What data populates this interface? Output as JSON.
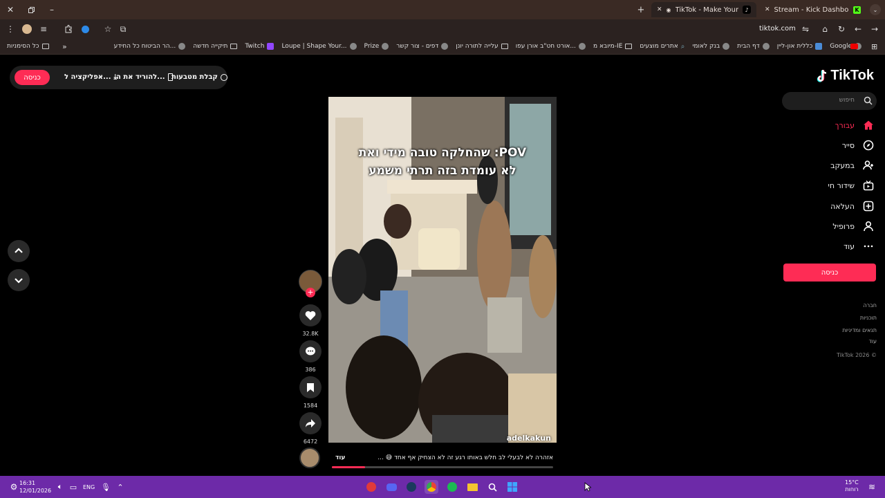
{
  "browser": {
    "tabs": [
      {
        "title": "TikTok - Make Your Day",
        "active": true
      },
      {
        "title": "Stream - Kick Dashboard",
        "active": false
      }
    ],
    "url": "tiktok.com",
    "bookmarks": [
      {
        "label": "Google",
        "icon": "google-icon"
      },
      {
        "label": "כללית און-ליין",
        "icon": "clalit-icon"
      },
      {
        "label": "דף הבית",
        "icon": "globe-icon"
      },
      {
        "label": "בנק לאומי",
        "icon": "globe-icon"
      },
      {
        "label": "אתרים מוצעים",
        "icon": "search-icon"
      },
      {
        "label": "מיובא מ-IE",
        "icon": "folder-icon"
      },
      {
        "label": "אורט חט\"ב אורן עפו...",
        "icon": "globe-icon"
      },
      {
        "label": "עלייה לתורה יונן",
        "icon": "folder-icon"
      },
      {
        "label": "דפים - צור קשר",
        "icon": "globe-icon"
      },
      {
        "label": "Prize",
        "icon": "globe-icon"
      },
      {
        "label": "Loupe | Shape Your...",
        "icon": "globe-icon"
      },
      {
        "label": "Twitch",
        "icon": "twitch-icon"
      },
      {
        "label": "תיקייה חדשה",
        "icon": "folder-icon"
      },
      {
        "label": "הר הביטוח כל החידע...",
        "icon": "globe-icon"
      }
    ],
    "all_bookmarks": "כל הסימניות"
  },
  "tiktok": {
    "logo": "TikTok",
    "login_top": "כניסה",
    "top_links": {
      "coins": "קבלת מטבעות",
      "download": "להוריד את ה...",
      "app": "אפליקציה ל..."
    },
    "search_placeholder": "חיפוש",
    "nav": [
      {
        "label": "עבורך",
        "icon": "home-icon",
        "active": true
      },
      {
        "label": "סייר",
        "icon": "compass-icon",
        "active": false
      },
      {
        "label": "במעקב",
        "icon": "following-icon",
        "active": false
      },
      {
        "label": "שידור חי",
        "icon": "live-icon",
        "active": false
      },
      {
        "label": "העלאה",
        "icon": "upload-icon",
        "active": false
      },
      {
        "label": "פרופיל",
        "icon": "profile-icon",
        "active": false
      },
      {
        "label": "עוד",
        "icon": "more-icon",
        "active": false
      }
    ],
    "login_side": "כניסה",
    "footer_links": [
      "חברה",
      "תוכניות",
      "תנאים ומדיניות",
      "עוד"
    ],
    "copyright": "TikTok 2026 ©",
    "video": {
      "overlay_line1": "POV: שהחלקה טובה מידי ואת",
      "overlay_line2": "לא עומדת בזה תרתי משמע",
      "username": "adelkakun",
      "caption": "אזהרה לא לבעלי לב חלש באותו רגע זה לא הצחיק אף אחד 😅 ...",
      "more": "עוד",
      "progress": 0.15
    },
    "actions": {
      "likes": "32.8K",
      "comments": "386",
      "saves": "1584",
      "shares": "6472"
    }
  },
  "taskbar": {
    "time": "16:31",
    "date": "12/01/2026",
    "lang": "ENG",
    "weather_temp": "15°C",
    "weather_desc": "רוחות"
  },
  "colors": {
    "accent": "#fe2c55",
    "taskbar": "#6d2aa8"
  }
}
